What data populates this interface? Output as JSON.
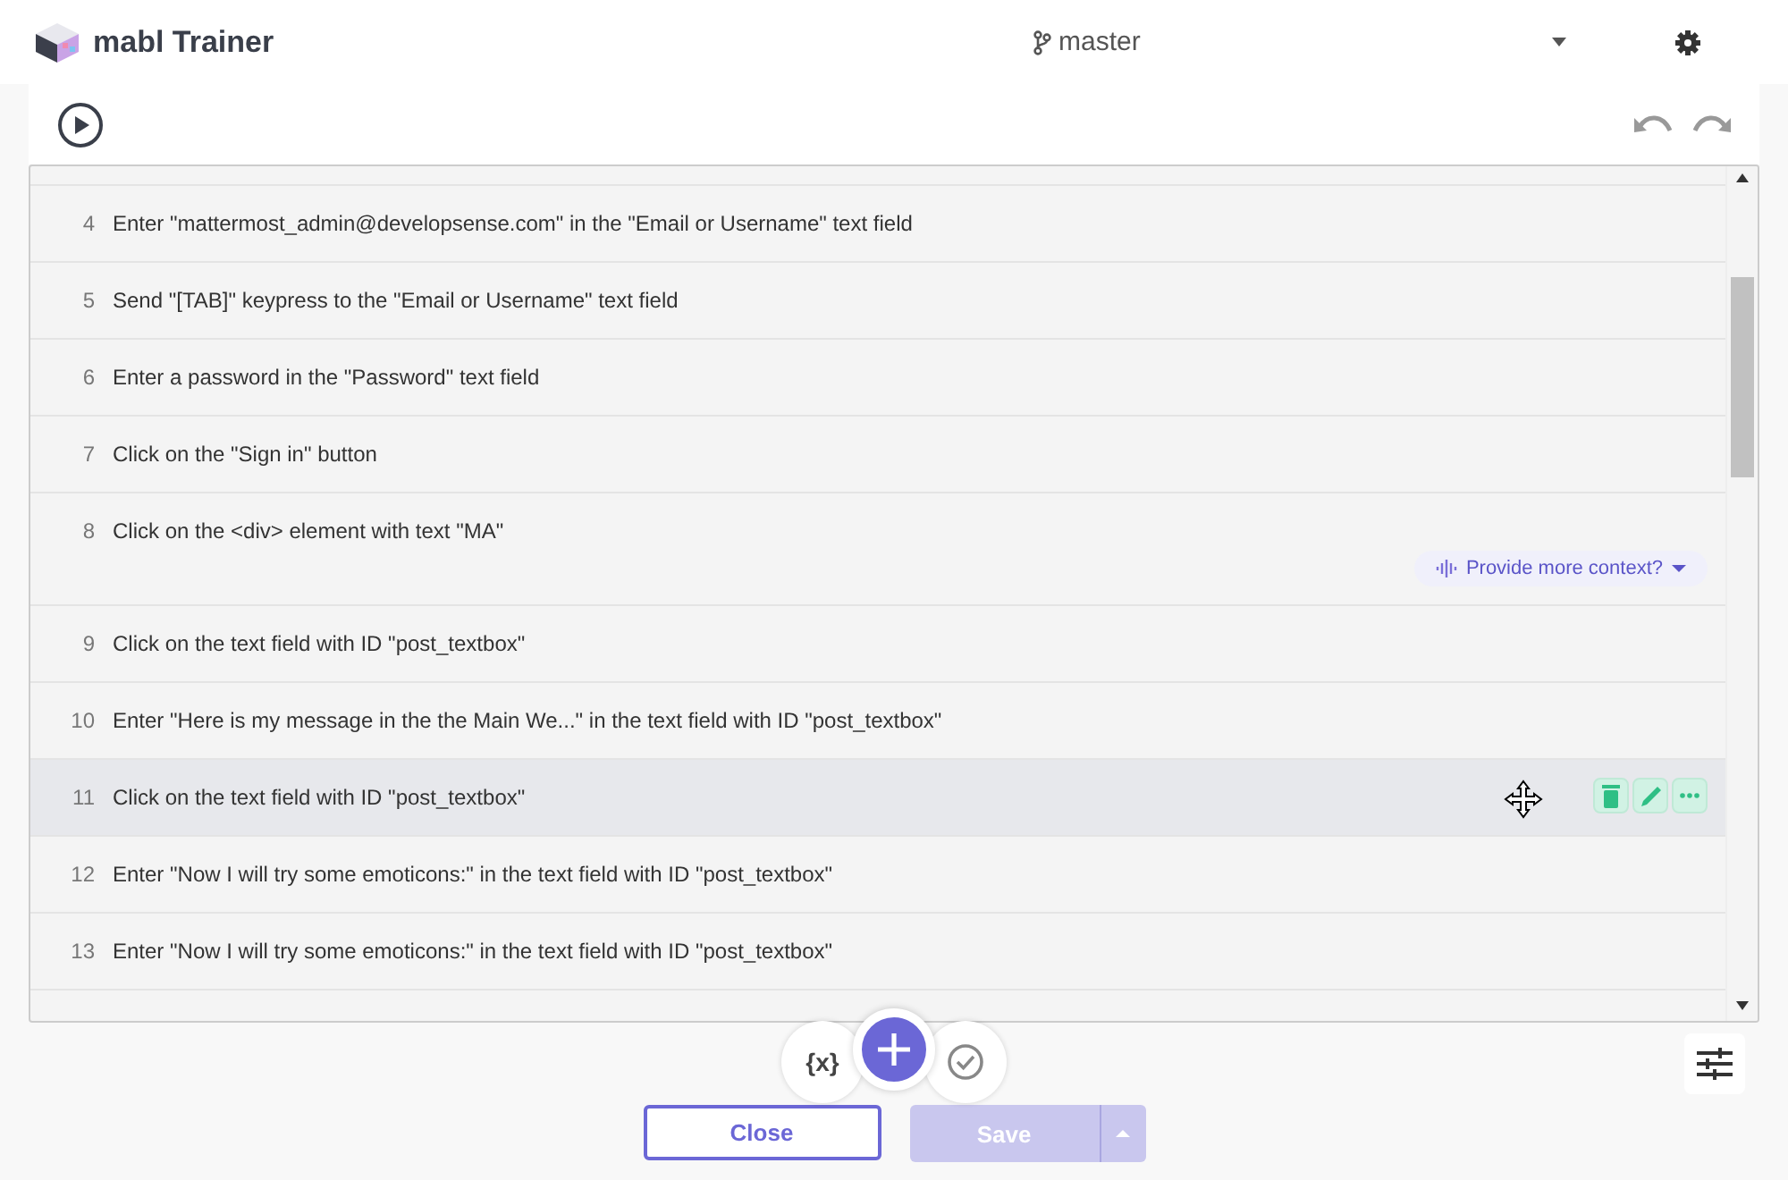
{
  "app": {
    "title": "mabl Trainer",
    "branch": "master"
  },
  "steps": [
    {
      "number": "4",
      "text": "Enter \"mattermost_admin@developsense.com\" in the \"Email or Username\" text field",
      "selected": false
    },
    {
      "number": "5",
      "text": "Send \"[TAB]\" keypress to the \"Email or Username\" text field",
      "selected": false
    },
    {
      "number": "6",
      "text": "Enter a password in the \"Password\" text field",
      "selected": false
    },
    {
      "number": "7",
      "text": "Click on the \"Sign in\" button",
      "selected": false
    },
    {
      "number": "8",
      "text": "Click on the <div> element with text \"MA\"",
      "selected": false,
      "context_prompt": "Provide more context?"
    },
    {
      "number": "9",
      "text": "Click on the text field with ID \"post_textbox\"",
      "selected": false
    },
    {
      "number": "10",
      "text": "Enter \"Here is my message in the the Main We...\" in the text field with ID \"post_textbox\"",
      "selected": false
    },
    {
      "number": "11",
      "text": "Click on the text field with ID \"post_textbox\"",
      "selected": true
    },
    {
      "number": "12",
      "text": "Enter \"Now I will try some emoticons:\" in the text field with ID \"post_textbox\"",
      "selected": false
    },
    {
      "number": "13",
      "text": "Enter \"Now I will try some emoticons:\" in the text field with ID \"post_textbox\"",
      "selected": false
    }
  ],
  "variables_label": "{x}",
  "buttons": {
    "close": "Close",
    "save": "Save",
    "save_disabled": true
  }
}
